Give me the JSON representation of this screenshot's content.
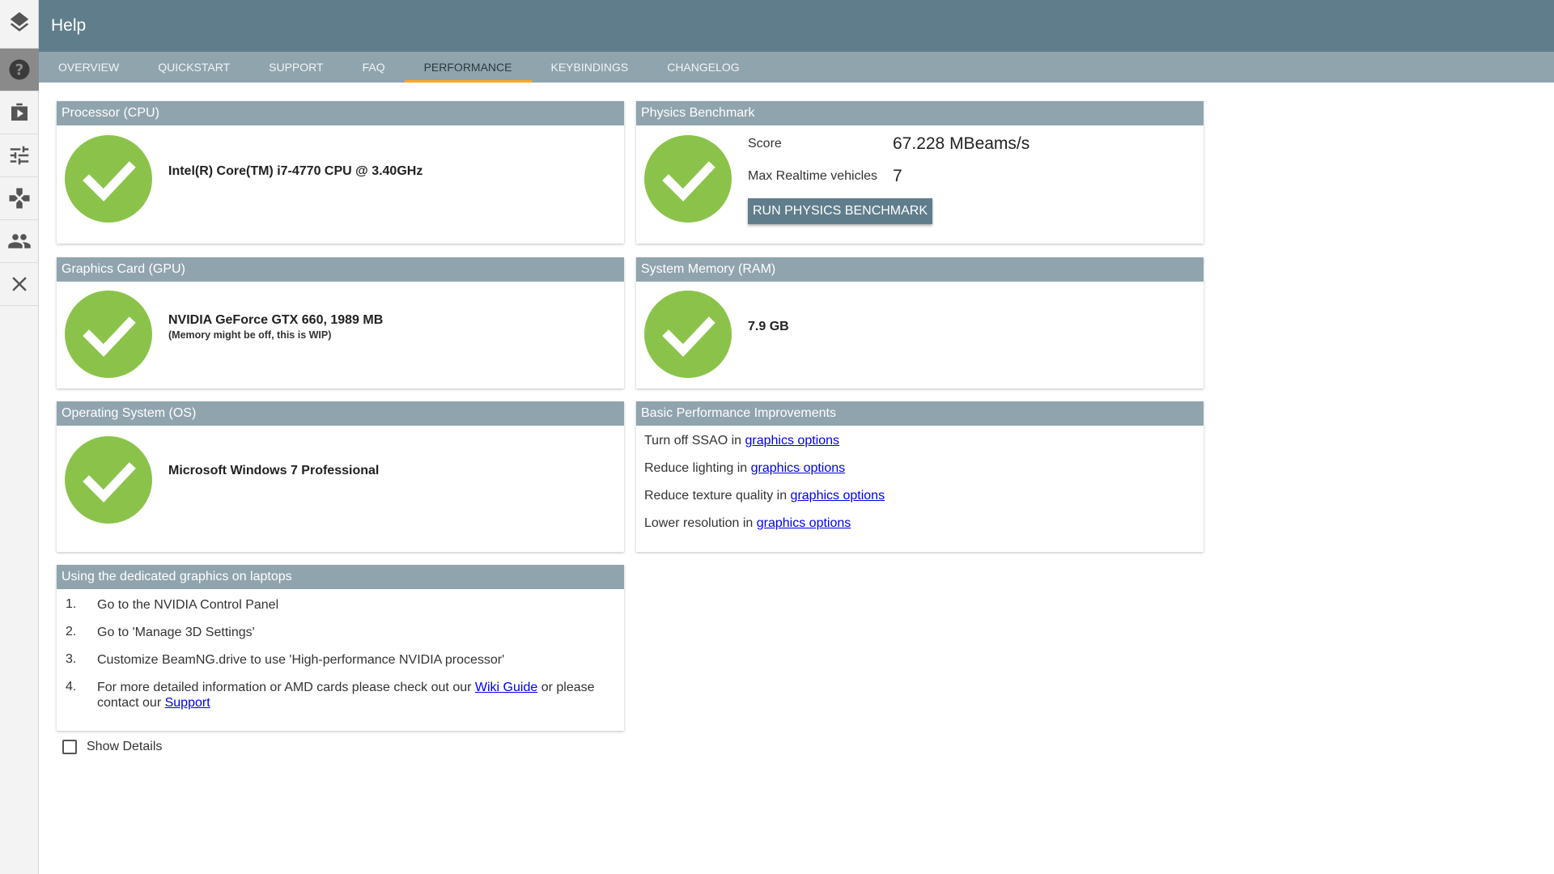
{
  "sidebar": {
    "items": [
      {
        "icon": "layers-icon"
      },
      {
        "icon": "help-icon",
        "active": true
      },
      {
        "icon": "play-icon"
      },
      {
        "icon": "tune-icon"
      },
      {
        "icon": "gamepad-icon"
      },
      {
        "icon": "people-icon"
      },
      {
        "icon": "close-icon"
      }
    ]
  },
  "header": {
    "title": "Help"
  },
  "tabs": [
    {
      "label": "OVERVIEW"
    },
    {
      "label": "QUICKSTART"
    },
    {
      "label": "SUPPORT"
    },
    {
      "label": "FAQ"
    },
    {
      "label": "PERFORMANCE",
      "active": true
    },
    {
      "label": "KEYBINDINGS"
    },
    {
      "label": "CHANGELOG"
    }
  ],
  "cpu": {
    "title": "Processor (CPU)",
    "value": "Intel(R) Core(TM) i7-4770 CPU @ 3.40GHz"
  },
  "gpu": {
    "title": "Graphics Card (GPU)",
    "value": "NVIDIA GeForce GTX 660, 1989 MB",
    "note": "(Memory might be off, this is WIP)"
  },
  "os": {
    "title": "Operating System (OS)",
    "value": "Microsoft Windows 7 Professional"
  },
  "physics": {
    "title": "Physics Benchmark",
    "score_label": "Score",
    "score_value": "67.228 MBeams/s",
    "vehicles_label": "Max Realtime vehicles",
    "vehicles_value": "7",
    "button_label": "RUN PHYSICS BENCHMARK"
  },
  "ram": {
    "title": "System Memory (RAM)",
    "value": "7.9 GB"
  },
  "improvements": {
    "title": "Basic Performance Improvements",
    "link_label": "graphics options",
    "items": [
      {
        "text": "Turn off SSAO in "
      },
      {
        "text": "Reduce lighting in "
      },
      {
        "text": "Reduce texture quality in "
      },
      {
        "text": "Lower resolution in "
      }
    ]
  },
  "laptops": {
    "title": "Using the dedicated graphics on laptops",
    "steps": [
      {
        "num": "1.",
        "text": "Go to the NVIDIA Control Panel"
      },
      {
        "num": "2.",
        "text": "Go to 'Manage 3D Settings'"
      },
      {
        "num": "3.",
        "text": "Customize BeamNG.drive to use 'High-performance NVIDIA processor'"
      },
      {
        "num": "4.",
        "text_before": "For more detailed information or AMD cards please check out our ",
        "wiki_link": "Wiki Guide",
        "text_middle": " or please contact our ",
        "support_link": "Support"
      }
    ]
  },
  "details": {
    "label": "Show Details",
    "checked": false
  },
  "colors": {
    "header": "#607d8b",
    "subheader": "#90a4ae",
    "check": "#8bc34a",
    "tab_indicator": "#ffa726"
  }
}
